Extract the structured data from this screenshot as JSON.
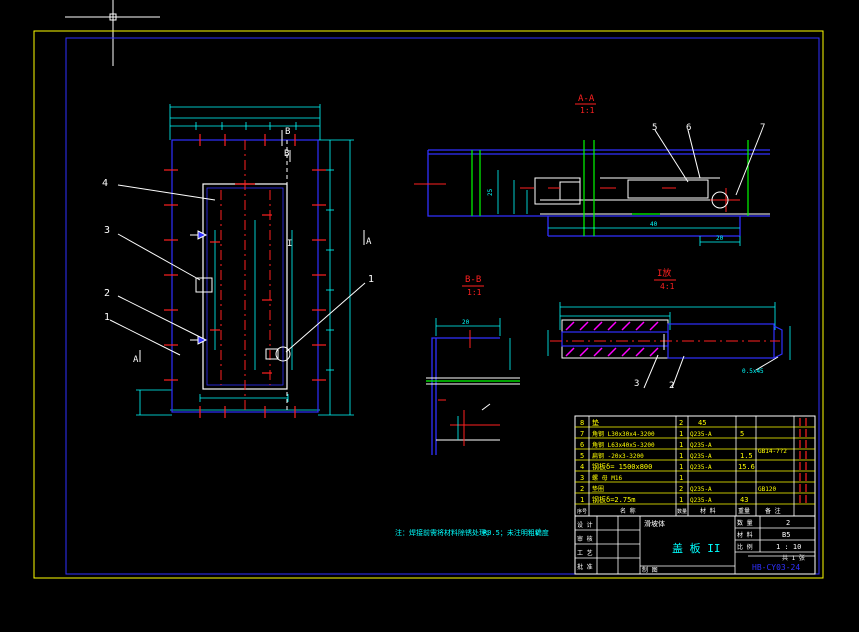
{
  "views": {
    "section_aa": {
      "title": "A-A",
      "scale": "1:1",
      "labels": [
        "5",
        "6",
        "7"
      ],
      "dims": [
        "25",
        "40",
        "20"
      ]
    },
    "section_bb": {
      "title": "B-B",
      "scale": "1:1",
      "dims": [
        "20"
      ]
    },
    "detail_i": {
      "title": "I放",
      "scale": "4:1",
      "labels": [
        "3",
        "2"
      ],
      "dims": [
        "0.5x45"
      ]
    },
    "plan": {
      "labels": [
        "4",
        "3",
        "2",
        "1"
      ],
      "section_marks": {
        "b_top": "B",
        "b_mid": "B",
        "a_left": "A",
        "a_right": "A",
        "i_mark": "I"
      }
    }
  },
  "note": {
    "text": "注：焊接前需将材料除锈处理；",
    "roughness": "R0.5；未注明粗糙度"
  },
  "parts_list": {
    "rows": [
      {
        "no": "8",
        "name": "垫",
        "qty": "2",
        "material": "45",
        "weight": "",
        "remark": ""
      },
      {
        "no": "7",
        "name": "角钢 L30x30x4-3200",
        "qty": "1",
        "material": "Q235-A",
        "weight": "5",
        "remark": ""
      },
      {
        "no": "6",
        "name": "角钢 L63x40x5-3200",
        "qty": "1",
        "material": "Q235-A",
        "weight": "",
        "remark": ""
      },
      {
        "no": "5",
        "name": "扁钢 -20x3-3200",
        "qty": "1",
        "material": "Q235-A",
        "weight": "1.5",
        "remark": ""
      },
      {
        "no": "4",
        "name": "钢板δ= 1500x800",
        "qty": "1",
        "material": "Q235-A",
        "weight": "15.6",
        "remark": "GB14-7?2"
      },
      {
        "no": "3",
        "name": "螺 母 M16",
        "qty": "1",
        "material": "",
        "weight": "",
        "remark": ""
      },
      {
        "no": "2",
        "name": "垫圈",
        "qty": "2",
        "material": "Q235-A",
        "weight": "",
        "remark": "GB120"
      },
      {
        "no": "1",
        "name": "钢板δ=2.75m",
        "qty": "1",
        "material": "Q235-A",
        "weight": "43",
        "remark": ""
      }
    ],
    "header": {
      "no": "序号",
      "name": "名 称",
      "qty": "数量",
      "material": "材 料",
      "weight": "重量",
      "remark": "备 注"
    }
  },
  "title_block": {
    "drawing_title": "盖 板 II",
    "project": "滑坡体",
    "scale_label": "比 例",
    "scale": "1 : 10",
    "count_label": "数 量",
    "count": "2",
    "material_label": "材 料",
    "material": "B5",
    "sheet": "共 1 张",
    "drawing_no": "HB-CY03-24",
    "rows_left": [
      "设 计",
      "审 核",
      "工 艺",
      "批 准",
      "制 图"
    ]
  },
  "colors": {
    "frame": "#ffff00",
    "outline": "#3030ff",
    "center": "#ff2020",
    "dimension": "#00ffff",
    "part": "#ffffff",
    "accent": "#00ff00",
    "hatch": "#ff00ff"
  }
}
